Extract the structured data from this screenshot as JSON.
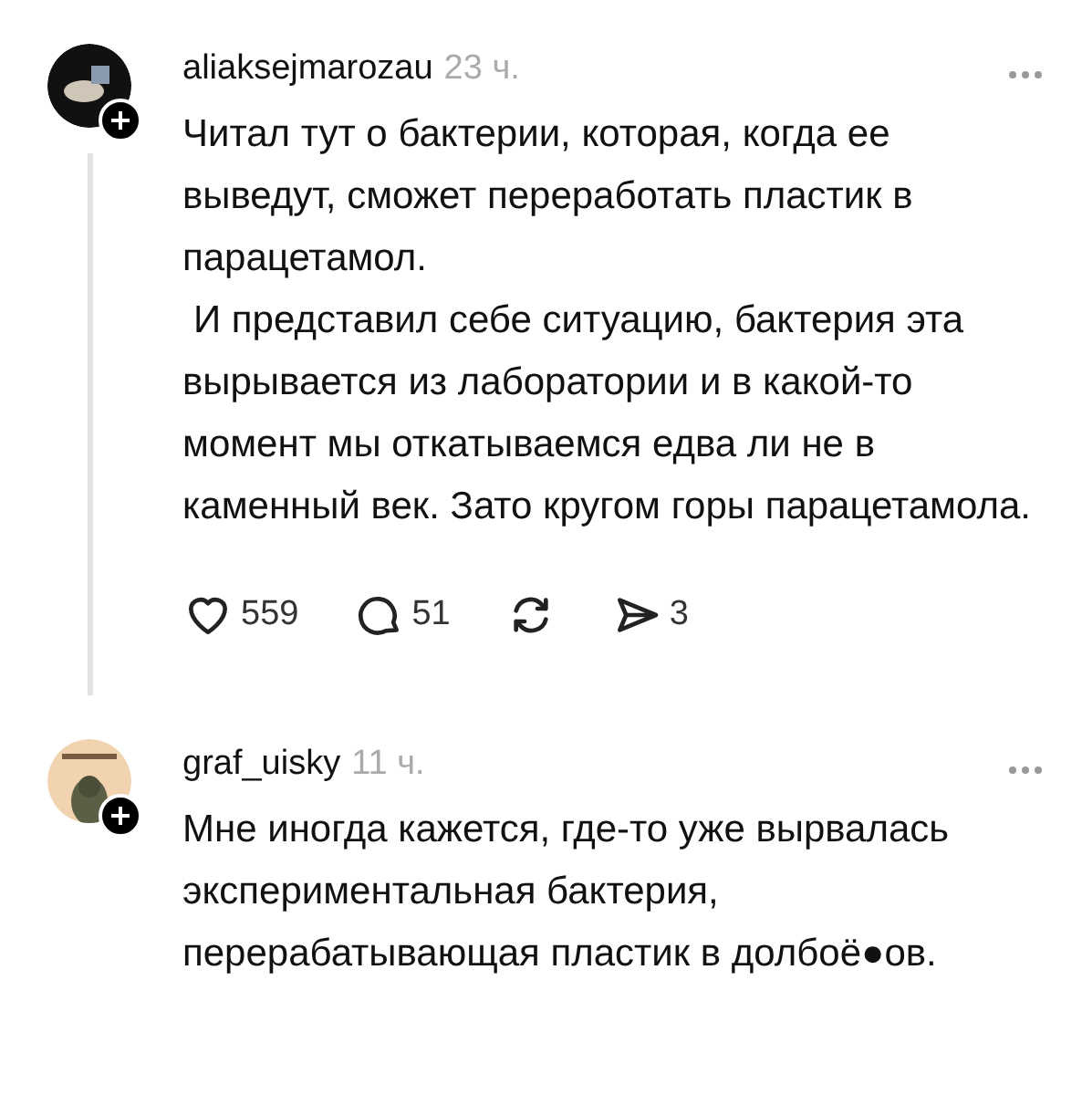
{
  "comments": [
    {
      "username": "aliaksejmarozau",
      "time": "23 ч.",
      "paragraphs": [
        "Читал тут о бактерии, которая, когда ее выведут, сможет переработать пластик в парацетамол.",
        "И представил себе ситуацию, бактерия эта вырывается из лаборатории и в какой-то момент мы откатываемся едва ли не в каменный век. Зато кругом горы парацетамола."
      ],
      "thread": true,
      "actions": [
        {
          "kind": "like",
          "count": "559"
        },
        {
          "kind": "reply",
          "count": "51"
        },
        {
          "kind": "repost"
        },
        {
          "kind": "share",
          "count": "3"
        }
      ]
    },
    {
      "username": "graf_uisky",
      "time": "11 ч.",
      "paragraphs": [
        "Мне иногда кажется, где-то уже вырвалась экспериментальная бактерия, перерабатывающая пластик в долбоё●ов."
      ],
      "thread": false
    }
  ]
}
